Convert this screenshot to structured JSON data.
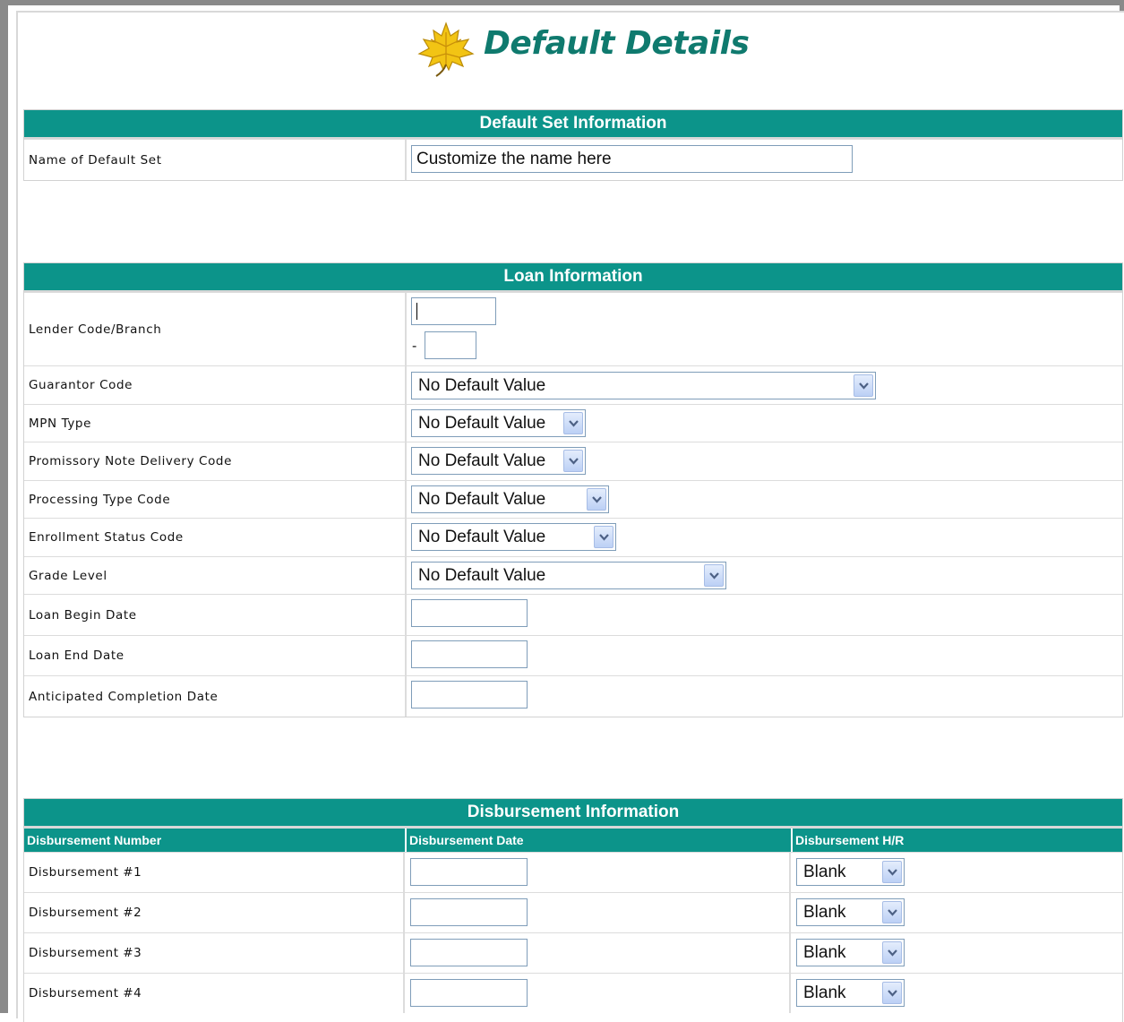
{
  "title": "Default Details",
  "colors": {
    "header_teal": "#0c948a",
    "title_green": "#0f7a6e",
    "logo_yellow": "#f2c414"
  },
  "icons": {
    "logo": "maple-leaf-icon",
    "dropdown": "chevron-down-icon"
  },
  "default_set": {
    "heading": "Default Set Information",
    "name_label": "Name of Default Set",
    "name_value": "Customize the name here"
  },
  "loan": {
    "heading": "Loan Information",
    "lender_label": "Lender Code/Branch",
    "lender_code": "",
    "branch_dash": "-",
    "branch": "",
    "guarantor_label": "Guarantor Code",
    "guarantor_value": "No Default Value",
    "mpn_label": "MPN Type",
    "mpn_value": "No Default Value",
    "promissory_label": "Promissory Note Delivery Code",
    "promissory_value": "No Default Value",
    "processing_label": "Processing Type Code",
    "processing_value": "No Default Value",
    "enrollment_label": "Enrollment Status Code",
    "enrollment_value": "No Default Value",
    "grade_label": "Grade Level",
    "grade_value": "No Default Value",
    "begin_label": "Loan Begin Date",
    "begin_value": "",
    "end_label": "Loan End Date",
    "end_value": "",
    "completion_label": "Anticipated Completion Date",
    "completion_value": ""
  },
  "disbursement": {
    "heading": "Disbursement Information",
    "columns": [
      "Disbursement Number",
      "Disbursement Date",
      "Disbursement H/R"
    ],
    "rows": [
      {
        "label": "Disbursement #1",
        "date": "",
        "hr": "Blank"
      },
      {
        "label": "Disbursement #2",
        "date": "",
        "hr": "Blank"
      },
      {
        "label": "Disbursement #3",
        "date": "",
        "hr": "Blank"
      },
      {
        "label": "Disbursement #4",
        "date": "",
        "hr": "Blank"
      }
    ]
  }
}
